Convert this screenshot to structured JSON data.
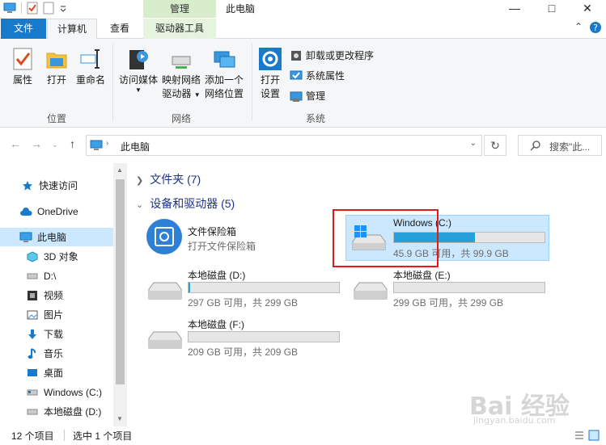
{
  "window": {
    "title": "此电脑",
    "manage_tab": "管理"
  },
  "tabs": {
    "file": "文件",
    "computer": "计算机",
    "view": "查看",
    "drive_tools": "驱动器工具"
  },
  "ribbon": {
    "properties": "属性",
    "open": "打开",
    "rename": "重命名",
    "access_media": "访问媒体",
    "map_drive_1": "映射网络",
    "map_drive_2": "驱动器",
    "add_network_1": "添加一个",
    "add_network_2": "网络位置",
    "open_settings_1": "打开",
    "open_settings_2": "设置",
    "uninstall": "卸载或更改程序",
    "system_properties": "系统属性",
    "manage": "管理",
    "group_location": "位置",
    "group_network": "网络",
    "group_system": "系统"
  },
  "address": {
    "path": "此电脑",
    "search_placeholder": "搜索\"此..."
  },
  "sidebar": {
    "items": [
      {
        "label": "快速访问",
        "icon": "star-icon"
      },
      {
        "label": "OneDrive",
        "icon": "cloud-icon"
      },
      {
        "label": "此电脑",
        "icon": "computer-icon"
      },
      {
        "label": "3D 对象",
        "icon": "cube-icon"
      },
      {
        "label": "D:\\",
        "icon": "drive-icon"
      },
      {
        "label": "视频",
        "icon": "video-icon"
      },
      {
        "label": "图片",
        "icon": "picture-icon"
      },
      {
        "label": "下载",
        "icon": "download-icon"
      },
      {
        "label": "音乐",
        "icon": "music-icon"
      },
      {
        "label": "桌面",
        "icon": "desktop-icon"
      },
      {
        "label": "Windows (C:)",
        "icon": "drive-icon"
      },
      {
        "label": "本地磁盘 (D:)",
        "icon": "drive-icon"
      }
    ]
  },
  "content": {
    "folders_header": "文件夹 (7)",
    "devices_header": "设备和驱动器 (5)",
    "vault_name": "文件保险箱",
    "vault_sub": "打开文件保险箱",
    "drives": [
      {
        "name": "Windows (C:)",
        "sub": "45.9 GB 可用，共 99.9 GB",
        "used_fraction": 0.54
      },
      {
        "name": "本地磁盘 (D:)",
        "sub": "297 GB 可用，共 299 GB",
        "used_fraction": 0.01
      },
      {
        "name": "本地磁盘 (E:)",
        "sub": "299 GB 可用，共 299 GB",
        "used_fraction": 0.0
      },
      {
        "name": "本地磁盘 (F:)",
        "sub": "209 GB 可用，共 209 GB",
        "used_fraction": 0.0
      }
    ]
  },
  "status": {
    "count": "12 个项目",
    "selected": "选中 1 个项目"
  },
  "watermark": {
    "main": "Bai 经验",
    "sub": "jingyan.baidu.com"
  },
  "colors": {
    "accent": "#1979ca",
    "selection": "#cce8ff",
    "bar_fill": "#26a0da",
    "highlight": "#e01b1b"
  }
}
